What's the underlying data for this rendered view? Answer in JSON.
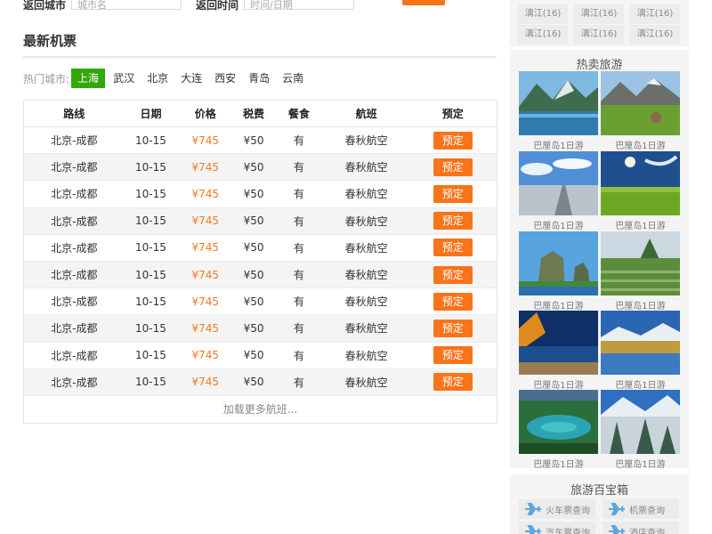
{
  "search_form": {
    "departure_city_label": "返回城市",
    "departure_city_placeholder": "城市名",
    "return_time_label": "返回时间",
    "return_time_placeholder": "时间/日期"
  },
  "section": {
    "title": "最新机票"
  },
  "hot_cities": {
    "label": "热门城市:",
    "cities": [
      "上海",
      "武汉",
      "北京",
      "大连",
      "西安",
      "青岛",
      "云南"
    ],
    "active_index": 0
  },
  "table": {
    "headers": [
      "路线",
      "日期",
      "价格",
      "税费",
      "餐食",
      "航班",
      "预定"
    ],
    "rows": [
      {
        "route": "北京-成都",
        "date": "10-15",
        "price": "¥745",
        "tax": "¥50",
        "meal": "有",
        "airline": "春秋航空",
        "action": "预定"
      },
      {
        "route": "北京-成都",
        "date": "10-15",
        "price": "¥745",
        "tax": "¥50",
        "meal": "有",
        "airline": "春秋航空",
        "action": "预定"
      },
      {
        "route": "北京-成都",
        "date": "10-15",
        "price": "¥745",
        "tax": "¥50",
        "meal": "有",
        "airline": "春秋航空",
        "action": "预定"
      },
      {
        "route": "北京-成都",
        "date": "10-15",
        "price": "¥745",
        "tax": "¥50",
        "meal": "有",
        "airline": "春秋航空",
        "action": "预定"
      },
      {
        "route": "北京-成都",
        "date": "10-15",
        "price": "¥745",
        "tax": "¥50",
        "meal": "有",
        "airline": "春秋航空",
        "action": "预定"
      },
      {
        "route": "北京-成都",
        "date": "10-15",
        "price": "¥745",
        "tax": "¥50",
        "meal": "有",
        "airline": "春秋航空",
        "action": "预定"
      },
      {
        "route": "北京-成都",
        "date": "10-15",
        "price": "¥745",
        "tax": "¥50",
        "meal": "有",
        "airline": "春秋航空",
        "action": "预定"
      },
      {
        "route": "北京-成都",
        "date": "10-15",
        "price": "¥745",
        "tax": "¥50",
        "meal": "有",
        "airline": "春秋航空",
        "action": "预定"
      },
      {
        "route": "北京-成都",
        "date": "10-15",
        "price": "¥745",
        "tax": "¥50",
        "meal": "有",
        "airline": "春秋航空",
        "action": "预定"
      },
      {
        "route": "北京-成都",
        "date": "10-15",
        "price": "¥745",
        "tax": "¥50",
        "meal": "有",
        "airline": "春秋航空",
        "action": "预定"
      }
    ],
    "load_more": "加载更多航班..."
  },
  "sidebar": {
    "top_links": [
      "漓江(16)",
      "漓江(16)",
      "漓江(16)",
      "漓江(16)",
      "漓江(16)",
      "漓江(16)"
    ],
    "hot_tours": {
      "title": "热卖旅游",
      "items": [
        {
          "caption": "巴厘岛1日游",
          "scene": "lake-mountains"
        },
        {
          "caption": "巴厘岛1日游",
          "scene": "meadow-mountains"
        },
        {
          "caption": "巴厘岛1日游",
          "scene": "salt-flat-road"
        },
        {
          "caption": "巴厘岛1日游",
          "scene": "green-field-moon"
        },
        {
          "caption": "巴厘岛1日游",
          "scene": "rock-pillars"
        },
        {
          "caption": "巴厘岛1日游",
          "scene": "terraced-ruins"
        },
        {
          "caption": "巴厘岛1日游",
          "scene": "autumn-lake-night"
        },
        {
          "caption": "巴厘岛1日游",
          "scene": "snowy-lakeside"
        },
        {
          "caption": "巴厘岛1日游",
          "scene": "tropical-lagoon"
        },
        {
          "caption": "巴厘岛1日游",
          "scene": "snowy-forest"
        }
      ]
    },
    "treasure": {
      "title": "旅游百宝箱",
      "tools": [
        "火车票查询",
        "机票查询",
        "汽车票查询",
        "酒店查询"
      ]
    }
  },
  "colors": {
    "accent_orange": "#f97319",
    "active_green": "#34a70a",
    "price_orange": "#f27a22",
    "icon_blue": "#5ba6e0"
  }
}
